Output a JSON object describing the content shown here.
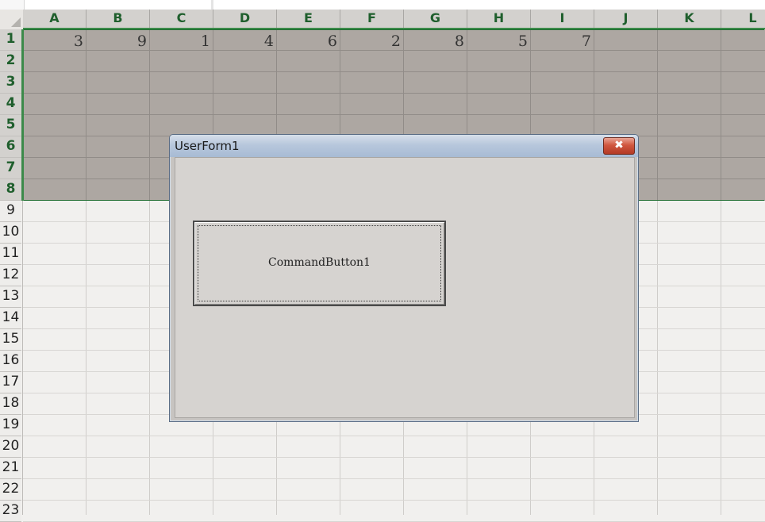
{
  "columns": [
    "A",
    "B",
    "C",
    "D",
    "E",
    "F",
    "G",
    "H",
    "I",
    "J",
    "K",
    "L"
  ],
  "rows": [
    "1",
    "2",
    "3",
    "4",
    "5",
    "6",
    "7",
    "8",
    "9",
    "10",
    "11",
    "12",
    "13",
    "14",
    "15",
    "16",
    "17",
    "18",
    "19",
    "20",
    "21",
    "22",
    "23"
  ],
  "row1_values": [
    "3",
    "9",
    "1",
    "4",
    "6",
    "2",
    "8",
    "5",
    "7"
  ],
  "selected_rows": 8,
  "dialog": {
    "title": "UserForm1",
    "close_symbol": "✖",
    "button_label": "CommandButton1"
  },
  "colors": {
    "header_text": "#1f5f2d",
    "selection_fill": "#ada7a2",
    "selection_border": "#1d6b2f"
  }
}
